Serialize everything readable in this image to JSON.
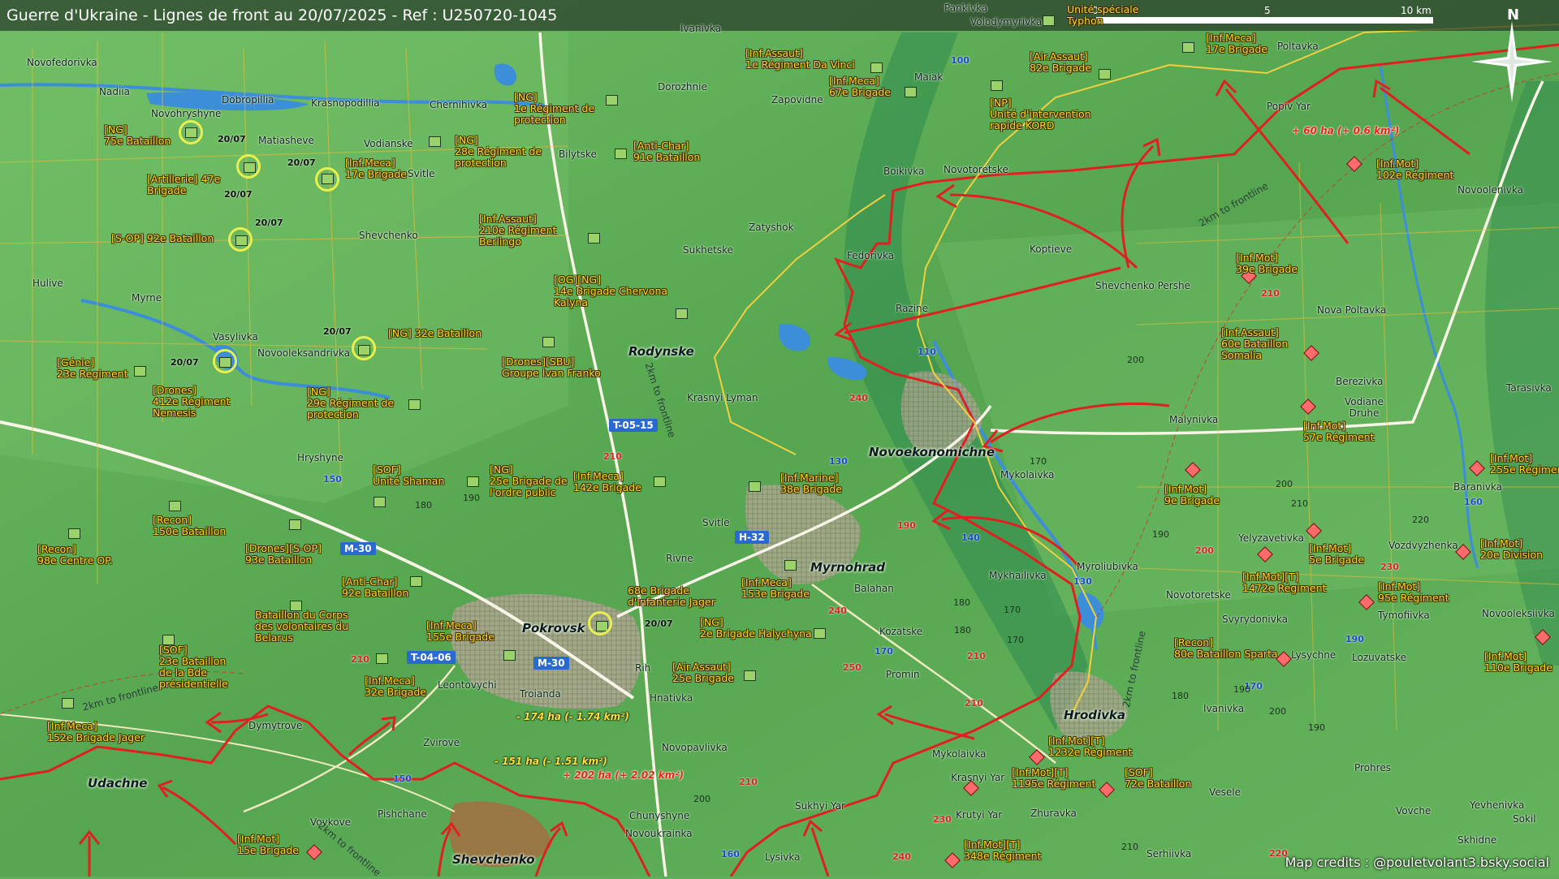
{
  "header": {
    "title": "Guerre d'Ukraine - Lignes de front au 20/07/2025 - Ref : U250720-1045"
  },
  "scale": {
    "labels": [
      "0",
      "5",
      "10 km"
    ]
  },
  "compass": {
    "label": "N"
  },
  "credits": "Map credits : @pouletvolant3.bsky.social",
  "colors": {
    "ua_fill": "#9bd36a",
    "ru_fill": "#ff6a6a",
    "frontline": "#e02020",
    "gain_ring": "#e8f050",
    "terrain": "#5fae5b",
    "title_bar": "#283c28"
  },
  "cities": {
    "pokrovsk": "Pokrovsk",
    "myrnohrad": "Myrnohrad",
    "rodynske": "Rodynske",
    "novoekonomichne": "Novoekonomichne",
    "udachne": "Udachne",
    "hrodivka": "Hrodivka",
    "shevchenko": "Shevchenko"
  },
  "towns": {
    "t1": "Novofedorivka",
    "t2": "Nadiia",
    "t3": "Dobropillia",
    "t4": "Krasnopodillia",
    "t5": "Chernihivka",
    "t6": "Novohryshyne",
    "t7": "Matiasheve",
    "t8": "Vodianske",
    "t9": "Svitle",
    "t10": "Bilytske",
    "t11": "Dorozhnie",
    "t12": "Ivanivka",
    "t13": "Zapovidne",
    "t14": "Pankivka",
    "t15": "Volodymyrivka",
    "t16": "Maiak",
    "t17": "Poltavka",
    "t18": "Popiv Yar",
    "t19": "Boikivka",
    "t20": "Novotoretske",
    "t21": "Shevchenko",
    "t22": "Sukhetske",
    "t23": "Zatyshok",
    "t24": "Fedorivka",
    "t25": "Koptieve",
    "t26": "Shevchenko Pershe",
    "t27": "Novoolenivka",
    "t28": "Razine",
    "t29": "Hulive",
    "t30": "Myrne",
    "t31": "Vasylivka",
    "t32": "Novooleksandrivka",
    "t33": "Krasnyi Lyman",
    "t34": "Nova Poltavka",
    "t35": "Berezivka",
    "t36": "Vodiane Druhe",
    "t37": "Malynivka",
    "t38": "Tarasivka",
    "t39": "Hryshyne",
    "t40": "Mykolaivka",
    "t41": "Baranivka",
    "t42": "Svitle",
    "t43": "Rivne",
    "t44": "Yelyzavetivka",
    "t45": "Vozdvyzhenka",
    "t46": "Myroliubivka",
    "t47": "Mykhailivka",
    "t48": "Balahan",
    "t49": "Novotoretske",
    "t50": "Svyrydonivka",
    "t51": "Tymofiivka",
    "t52": "Novooleksiivka",
    "t53": "Kozatske",
    "t54": "Lysychne",
    "t55": "Lozuvatske",
    "t56": "Rih",
    "t57": "Promin",
    "t58": "Leontovychi",
    "t59": "Troianda",
    "t60": "Hnativka",
    "t61": "Dymytrove",
    "t62": "Zvirove",
    "t63": "Novopavlivka",
    "t64": "Ivanivka",
    "t65": "Mykolaivka",
    "t66": "Krasnyi Yar",
    "t67": "Krutyi Yar",
    "t68": "Zhuravka",
    "t69": "Vesele",
    "t70": "Prohres",
    "t71": "Yevhenivka",
    "t72": "Sokil",
    "t73": "Vovkove",
    "t74": "Pishchane",
    "t75": "Chunyshyne",
    "t76": "Sukhyi Yar",
    "t77": "Novoukrainka",
    "t78": "Vovche",
    "t79": "Skhidne",
    "t80": "Serhiivka",
    "t81": "Lysivka"
  },
  "units": {
    "u1": "[NG]\n75e Bataillon",
    "u2": "[Artillerie] 47e\nBrigade",
    "u3": "[Inf.Meca]\n17e Brigade",
    "u4": "[S-OP] 92e Bataillon",
    "u5": "[NG]\n28e Régiment de\nprotection",
    "u6": "[NG]\n1e Régiment de\nprotection",
    "u7": "[Anti-Char]\n91e Bataillon",
    "u8": "[Inf.Assaut]\n1e Régiment Da Vinci",
    "u9": "[Inf.Meca]\n67e Brigade",
    "u10": "[NP]\nUnité d'intervention\nrapide KORD",
    "u11": "[Air.Assaut]\n82e Brigade",
    "u12": "[Inf.Meca]\n17e Brigade",
    "u13": "Unité spéciale\nTyphon",
    "u14": "[Inf.Assaut]\n210e Régiment\nBerlingo",
    "u15": "[OG][NG]\n14e Brigade Chervona\nKalyna",
    "u16": "[Génie]\n23e Régiment",
    "u17": "[Drones]\n412e Régiment\nNemesis",
    "u18": "[NG] 32e Bataillon",
    "u19": "[NG]\n29e Régiment de\nprotection",
    "u20": "[Drones][SBU]\nGroupe Ivan Franko",
    "u21": "[SOF]\nUnité Shaman",
    "u22": "[NG]\n25e Brigade de\nl'ordre public",
    "u23": "[Inf.Meca]\n142e Brigade",
    "u24": "[Inf.Marine]\n38e Brigade",
    "u25": "[Recon]\n150e Bataillon",
    "u26": "[Recon]\n98e Centre OP.",
    "u27": "[Drones][S-OP]\n93e Bataillon",
    "u28": "[Anti-Char]\n92e Bataillon",
    "u29": "Bataillon du Corps\ndes volontaires du\nBelarus",
    "u30": "[SOF]\n23e Bataillon\nde la Bde\nprésidentielle",
    "u31": "[Inf.Meca]\n155e Brigade",
    "u32": "68e Brigade\nd'infanterie Jager",
    "u33": "[Inf.Meca]\n153e Brigade",
    "u34": "[NG]\n2e Brigade Halychyna",
    "u35": "[Air.Assaut]\n25e Brigade",
    "u36": "[Inf.Meca]\n32e Brigade",
    "u37": "[Inf.Meca]\n152e Brigade Jager",
    "u38": "[Inf.Mot]\n15e Brigade",
    "u39": "[Inf.Mot]\n102e Régiment",
    "u40": "[Inf.Mot]\n39e Brigade",
    "u41": "[Inf.Assaut]\n60e Bataillon\nSomalia",
    "u42": "[Inf.Mot]\n57e Régiment",
    "u43": "[Inf.Mot]\n9e Brigade",
    "u44": "[Inf.Mot]\n255e Régiment",
    "u45": "[Inf.Mot]\n5e Brigade",
    "u46": "[Inf.Mot][T]\n1472e Régiment",
    "u47": "[Inf.Mot]\n20e Division",
    "u48": "[Inf.Mot]\n95e Régiment",
    "u49": "[Recon]\n80e Bataillon Sparta",
    "u50": "[Inf.Mot]\n110e Brigade",
    "u51": "[Inf.Mot][T]\n1232e Régiment",
    "u52": "[Inf.Mot][T]\n1195e Régiment",
    "u53": "[SOF]\n72e Bataillon",
    "u54": "[Inf.Mot][T]\n348e Régiment"
  },
  "dates": {
    "d": "20/07"
  },
  "roads": {
    "t0515": "T-05-15",
    "h32": "H-32",
    "m30a": "M-30",
    "m30b": "M-30",
    "t0406": "T-04-06"
  },
  "road_numbers": {
    "r1": "100",
    "r2": "110",
    "r3": "130",
    "r4": "150",
    "r5": "130",
    "r6": "140",
    "r7": "170",
    "r8": "160",
    "r9": "190",
    "r10": "170",
    "r11": "160",
    "r12": "150"
  },
  "red_numbers": {
    "n1": "210",
    "n2": "240",
    "n3": "210",
    "n4": "190",
    "n5": "200",
    "n6": "230",
    "n7": "240",
    "n8": "210",
    "n9": "250",
    "n10": "210",
    "n11": "210",
    "n12": "210",
    "n13": "230",
    "n14": "240",
    "n15": "220"
  },
  "elevations": {
    "e1": "200",
    "e2": "170",
    "e3": "200",
    "e4": "210",
    "e5": "220",
    "e6": "190",
    "e7": "180",
    "e8": "190",
    "e9": "180",
    "e10": "170",
    "e11": "180",
    "e12": "170",
    "e13": "190",
    "e14": "200",
    "e15": "190",
    "e16": "180",
    "e17": "210",
    "e18": "200"
  },
  "gains": {
    "g1": "+ 60 ha (+ 0.6 km²)",
    "g2": "- 174 ha (- 1.74 km²)",
    "g3": "- 151 ha (- 1.51 km²)",
    "g4": "+ 202 ha (+ 2.02 km²)"
  },
  "frontline_labels": {
    "f": "2km to frontline"
  }
}
